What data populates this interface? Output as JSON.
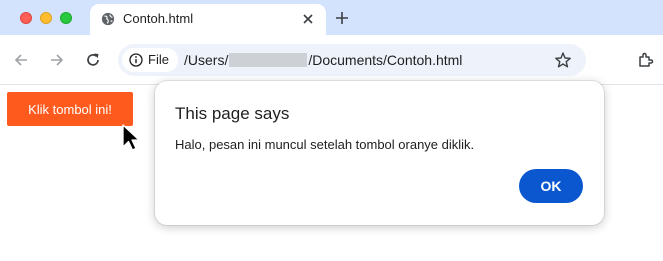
{
  "browser": {
    "tab": {
      "title": "Contoh.html",
      "favicon": "globe-icon"
    },
    "omnibox": {
      "chip_label": "File",
      "url_prefix": "/Users/",
      "url_suffix": "/Documents/Contoh.html"
    },
    "colors": {
      "tabstrip": "#d3e3fd",
      "omnibox": "#eef3fb"
    }
  },
  "page": {
    "button_label": "Klik tombol ini!",
    "button_color": "#fe5a1d"
  },
  "dialog": {
    "title": "This page says",
    "message": "Halo, pesan ini muncul setelah tombol oranye diklik.",
    "ok_label": "OK",
    "ok_color": "#0b57d0"
  }
}
